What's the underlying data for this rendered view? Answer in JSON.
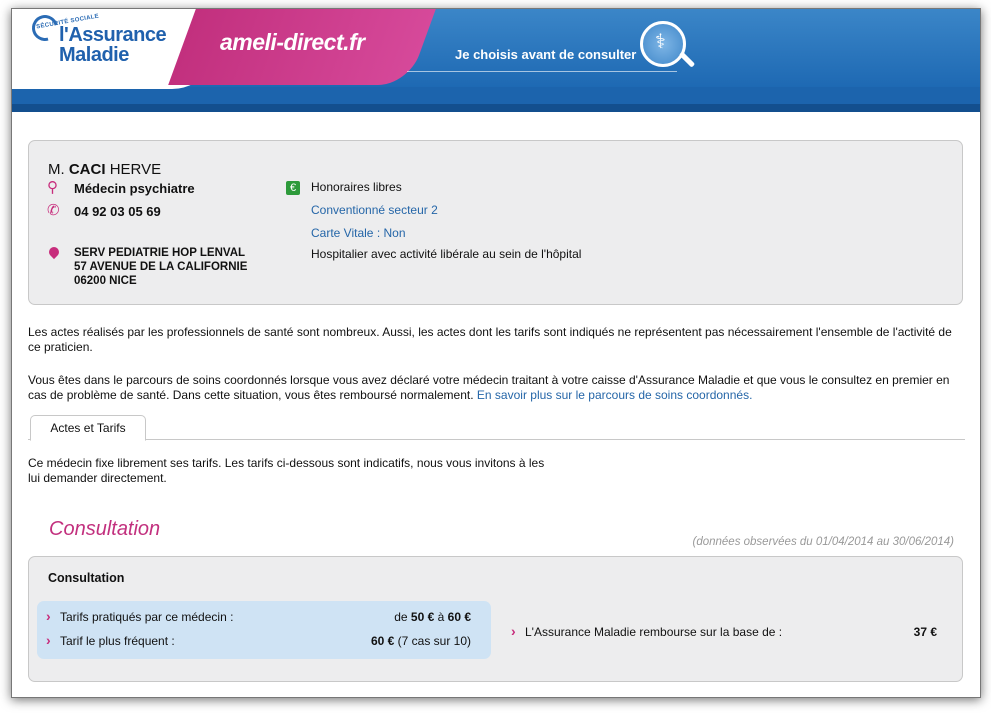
{
  "header": {
    "logo_small": "SÉCURITÉ SOCIALE",
    "logo_line1": "l'Assurance",
    "logo_line2": "Maladie",
    "brand": "ameli-direct.fr",
    "tagline": "Je choisis avant de consulter"
  },
  "doctor": {
    "title": "M.",
    "last_name": "CACI",
    "first_name": "HERVE",
    "specialty": "Médecin psychiatre",
    "phone": "04 92 03 05 69",
    "address_line1": "SERV PEDIATRIE HOP LENVAL",
    "address_line2": "57 AVENUE DE LA CALIFORNIE",
    "address_line3": "06200 NICE",
    "honoraires": "Honoraires libres",
    "secteur": "Conventionné secteur 2",
    "vitale": "Carte Vitale : Non",
    "hospitalier": "Hospitalier avec activité libérale au sein de l'hôpital"
  },
  "info": {
    "para1": "Les actes réalisés par les professionnels de santé sont nombreux. Aussi, les actes dont les tarifs sont indiqués ne représentent pas nécessairement l'ensemble de l'activité de ce praticien.",
    "para2": "Vous êtes dans le parcours de soins coordonnés lorsque vous avez déclaré votre médecin traitant à votre caisse d'Assurance Maladie et que vous le consultez en premier en cas de problème de santé. Dans cette situation, vous êtes remboursé normalement.",
    "para2_link": "En savoir plus sur le parcours de soins coordonnés."
  },
  "tabs": {
    "active": "Actes et Tarifs"
  },
  "tarifs_intro": "Ce médecin fixe librement ses tarifs. Les tarifs ci-dessous sont indicatifs, nous vous invitons à les lui demander directement.",
  "consultation": {
    "section_title": "Consultation",
    "observed": "(données observées du 01/04/2014 au 30/06/2014)",
    "box_title": "Consultation",
    "row1_label": "Tarifs pratiqués par ce médecin :",
    "row1_prefix": "de",
    "row1_min": "50 €",
    "row1_mid": "à",
    "row1_max": "60 €",
    "row2_label": "Tarif le plus fréquent :",
    "row2_value": "60 €",
    "row2_note": "(7 cas sur 10)",
    "row3_label": "L'Assurance Maladie rembourse sur la base de :",
    "row3_value": "37 €"
  },
  "colors": {
    "brand_pink": "#c2307e",
    "brand_blue": "#1e69b3",
    "link_blue": "#2566a8",
    "euro_green": "#2d9a3a"
  }
}
